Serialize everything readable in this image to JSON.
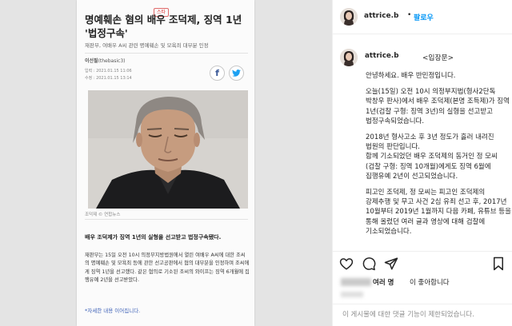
{
  "article": {
    "tag": "스타",
    "title": "명예훼손 혐의 배우 조덕제, 징역 1년 '법정구속'",
    "subtitle": "재판부, 여배우 A씨 관련 명예훼손 및 모욕죄 대부분 인정",
    "author": "이선필",
    "author_handle": "(thebasic3)",
    "time_input": "입력 : 2021.01.15 11:06",
    "time_edit": "수정 : 2021.01.15 13:14",
    "facebook_label": "f",
    "twitter_label": "t",
    "photo_credit": "조덕제 © 연합뉴스",
    "lead": "배우 조덕제가 징역 1년의 실형을 선고받고 법정구속됐다.",
    "body": "재판부는 15일 오전 10시 의정부지방법원에서 열린 여배우 A씨에 대한 조씨의 명예훼손 및 모욕죄 등에 관한 선고공판에서 혐의 대부분을 인정하며 조씨에게 징역 1년을 선고했다. 같은 혐의로 기소된 조씨의 와이프는 징역 6개월에 집행유예 2년을 선고받았다.",
    "more": "*자세한 내용 이어집니다."
  },
  "header": {
    "username": "attrice.b",
    "separator": "•",
    "follow_label": "팔로우"
  },
  "comment": {
    "username": "attrice.b",
    "subtitle": "<입장문>",
    "paragraphs": [
      "안녕하세요. 배우 반민정입니다.",
      "오늘(15일) 오전 10시 의정부지법(형사2단독 박창우 판사)에서 배우 조덕제(본명 조득제)가 징역 1년(검찰 구형: 징역 3년)의 실형을 선고받고 법정구속되었습니다.",
      "2018년 형사고소 후 3년 정도가 흘러 내려진 법원의 판단입니다.",
      "함께 기소되었던 배우 조덕제의 동거인 정 모씨(검찰 구형: 징역 10개월)에게도 징역 6월에 집행유예 2년이 선고되었습니다.",
      "피고인 조덕제, 정 모씨는 피고인 조덕제의 강제추행 및 무고 사건 2심 유죄 선고 후, 2017년 10월부터 2019년 1월까지 다음 카페, 유튜브 등을 통해 올렸던 여러 글과 영상에 대해 검찰에 기소되었습니다."
    ]
  },
  "likes": {
    "count_label": "여러 명",
    "suffix": "이 좋아합니다"
  },
  "footer": {
    "notice": "이 게시물에 대한 댓글 기능이 제한되었습니다."
  },
  "icons": [
    "heart-icon",
    "comment-icon",
    "share-icon",
    "bookmark-icon"
  ],
  "colors": {
    "follow": "#0095f6",
    "muted": "#8e8e8e",
    "link": "#3b5fb6"
  }
}
